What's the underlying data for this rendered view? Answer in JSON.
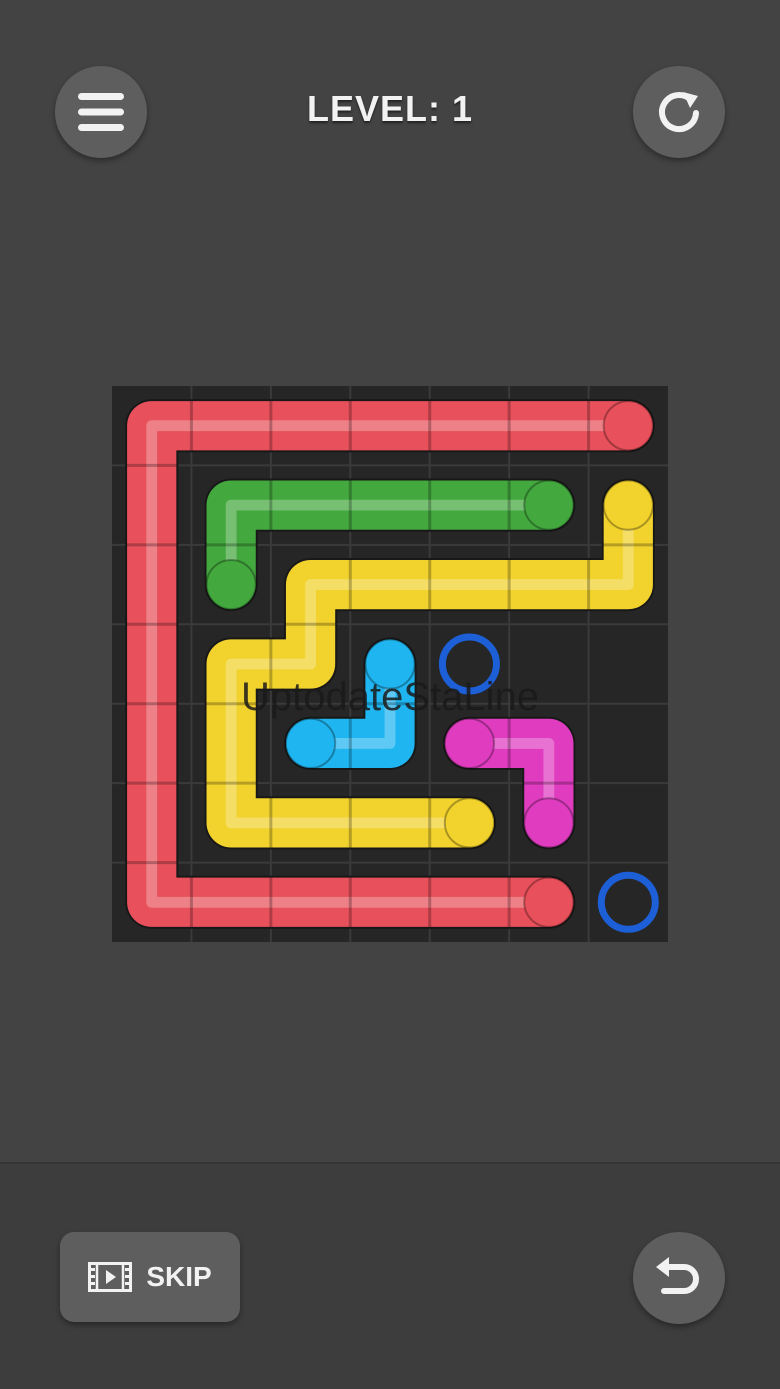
{
  "header": {
    "level_label": "LEVEL: 1",
    "menu_icon": "hamburger-menu-icon",
    "restart_icon": "restart-icon"
  },
  "board": {
    "grid_size": 7,
    "watermark_text": "UptodateStaLine",
    "colors": {
      "red": "#e8505b",
      "green": "#43a83e",
      "yellow": "#f2d22c",
      "cyan": "#1fb5f0",
      "magenta": "#e03cc0",
      "blue_endpoint": "#1d5fd6",
      "board_bg": "#262626",
      "grid_line": "#3a3a3a"
    },
    "pipes": [
      {
        "color": "red",
        "cells": [
          [
            6,
            0
          ],
          [
            5,
            0
          ],
          [
            4,
            0
          ],
          [
            3,
            0
          ],
          [
            2,
            0
          ],
          [
            1,
            0
          ],
          [
            0,
            0
          ],
          [
            0,
            1
          ],
          [
            0,
            2
          ],
          [
            0,
            3
          ],
          [
            0,
            4
          ],
          [
            0,
            5
          ],
          [
            0,
            6
          ],
          [
            1,
            6
          ],
          [
            2,
            6
          ],
          [
            3,
            6
          ],
          [
            4,
            6
          ],
          [
            5,
            6
          ]
        ]
      },
      {
        "color": "green",
        "cells": [
          [
            5,
            1
          ],
          [
            4,
            1
          ],
          [
            3,
            1
          ],
          [
            2,
            1
          ],
          [
            1,
            1
          ],
          [
            1,
            2
          ]
        ]
      },
      {
        "color": "yellow",
        "cells": [
          [
            6,
            1
          ],
          [
            6,
            2
          ],
          [
            5,
            2
          ],
          [
            4,
            2
          ],
          [
            3,
            2
          ],
          [
            2,
            2
          ],
          [
            2,
            3
          ],
          [
            1,
            3
          ],
          [
            1,
            4
          ],
          [
            1,
            5
          ],
          [
            2,
            5
          ],
          [
            3,
            5
          ],
          [
            4,
            5
          ]
        ]
      },
      {
        "color": "cyan",
        "cells": [
          [
            3,
            3
          ],
          [
            3,
            4
          ],
          [
            2,
            4
          ]
        ]
      },
      {
        "color": "magenta",
        "cells": [
          [
            4,
            4
          ],
          [
            5,
            4
          ],
          [
            5,
            5
          ]
        ]
      }
    ],
    "open_endpoints": [
      {
        "color": "blue_endpoint",
        "cell": [
          4,
          3
        ]
      },
      {
        "color": "blue_endpoint",
        "cell": [
          6,
          6
        ]
      }
    ]
  },
  "footer": {
    "skip_label": "SKIP",
    "skip_icon": "video-film-icon",
    "undo_icon": "undo-icon"
  }
}
